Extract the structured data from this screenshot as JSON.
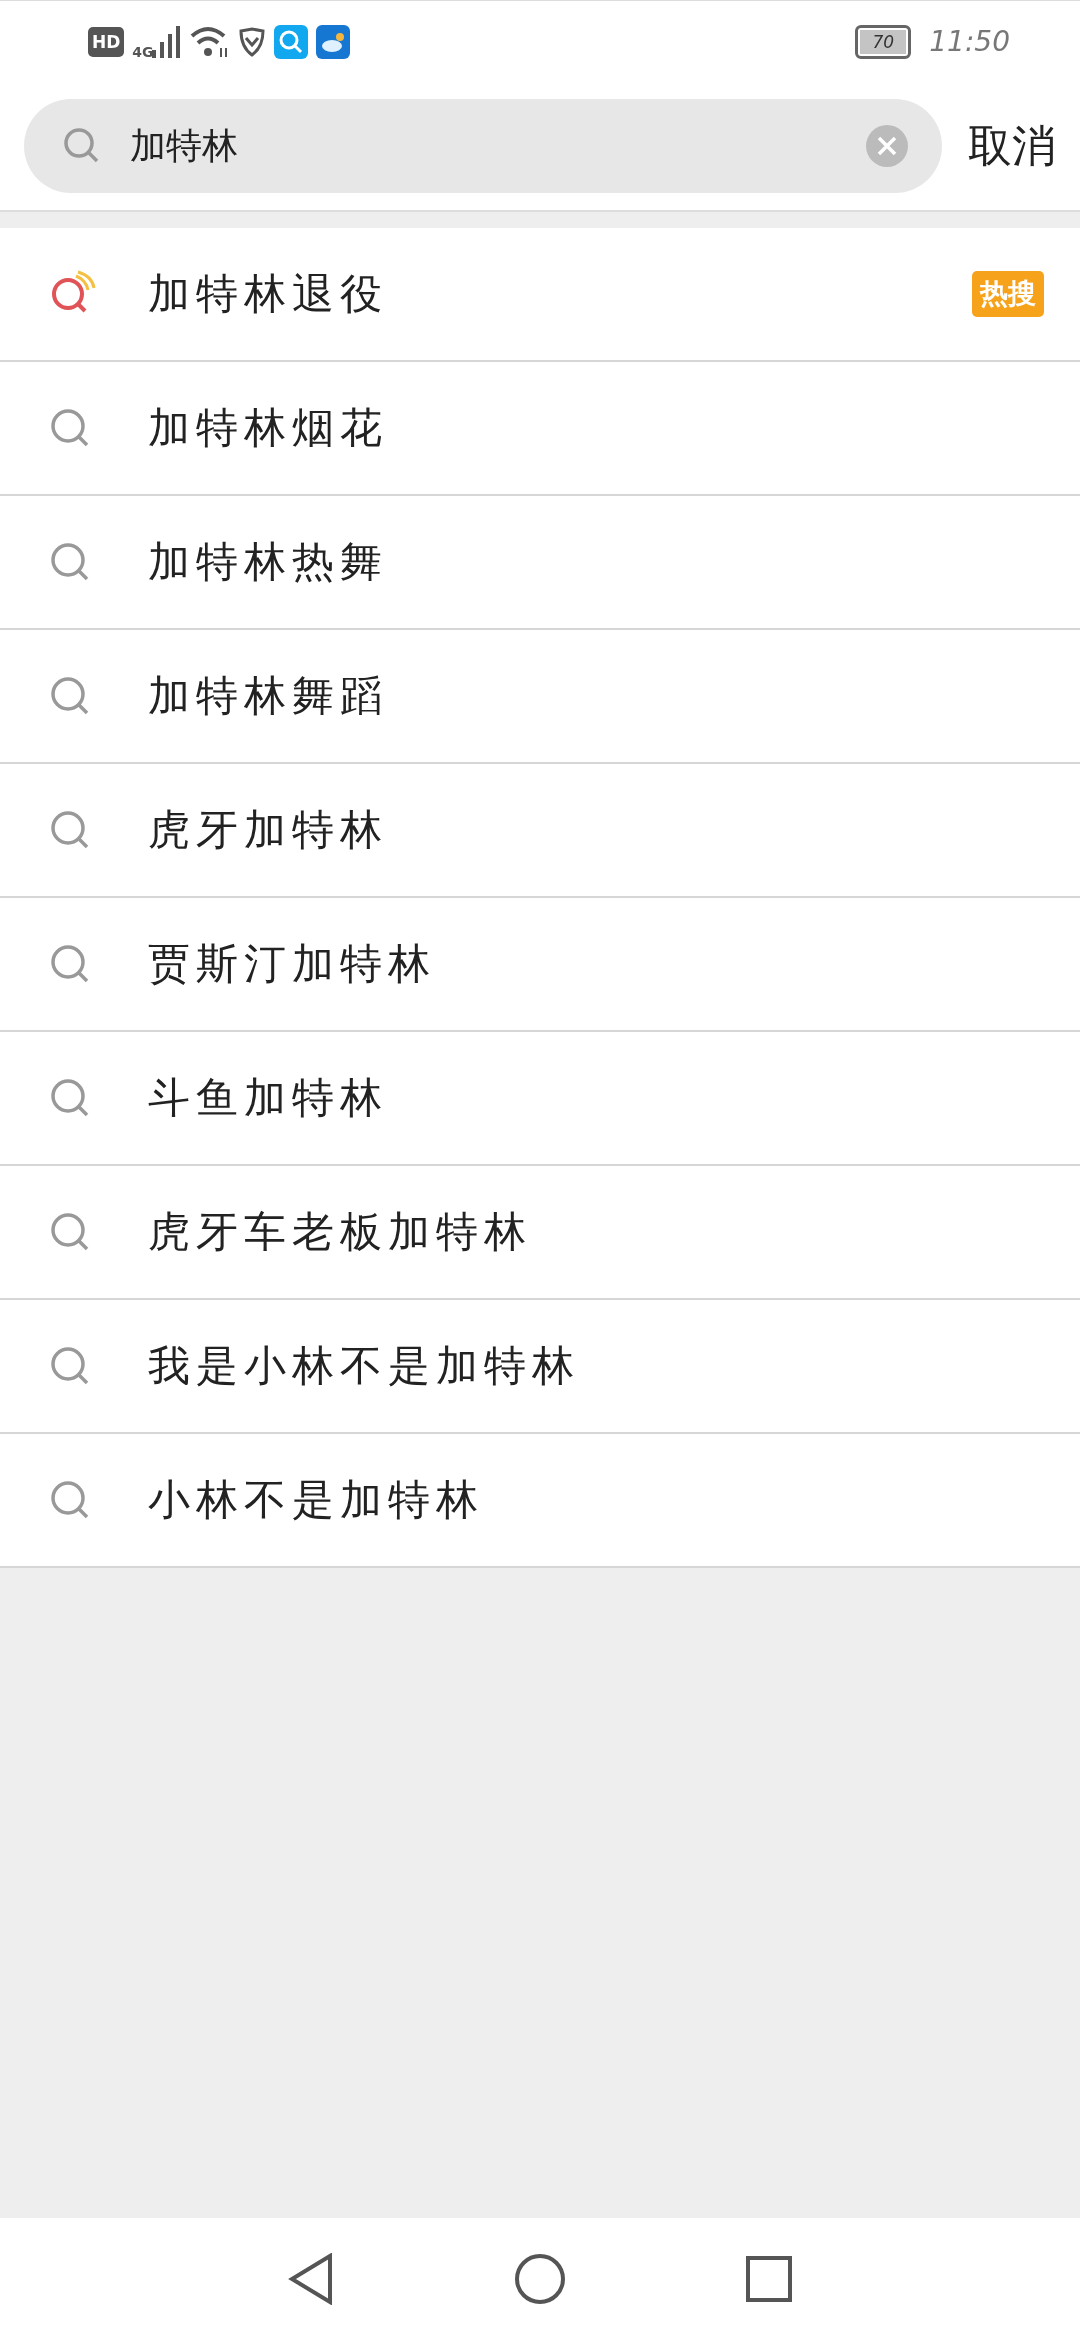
{
  "status_bar": {
    "hd": "HD",
    "network": "4G",
    "battery": "70",
    "time": "11:50"
  },
  "search": {
    "value": "加特林"
  },
  "cancel": "取消",
  "suggestions": [
    {
      "text": "加特林退役",
      "kind": "hot",
      "badge": "热搜"
    },
    {
      "text": "加特林烟花",
      "kind": "normal"
    },
    {
      "text": "加特林热舞",
      "kind": "normal"
    },
    {
      "text": "加特林舞蹈",
      "kind": "normal"
    },
    {
      "text": "虎牙加特林",
      "kind": "normal"
    },
    {
      "text": "贾斯汀加特林",
      "kind": "normal"
    },
    {
      "text": "斗鱼加特林",
      "kind": "normal"
    },
    {
      "text": "虎牙车老板加特林",
      "kind": "normal"
    },
    {
      "text": "我是小林不是加特林",
      "kind": "normal"
    },
    {
      "text": "小林不是加特林",
      "kind": "normal"
    }
  ]
}
